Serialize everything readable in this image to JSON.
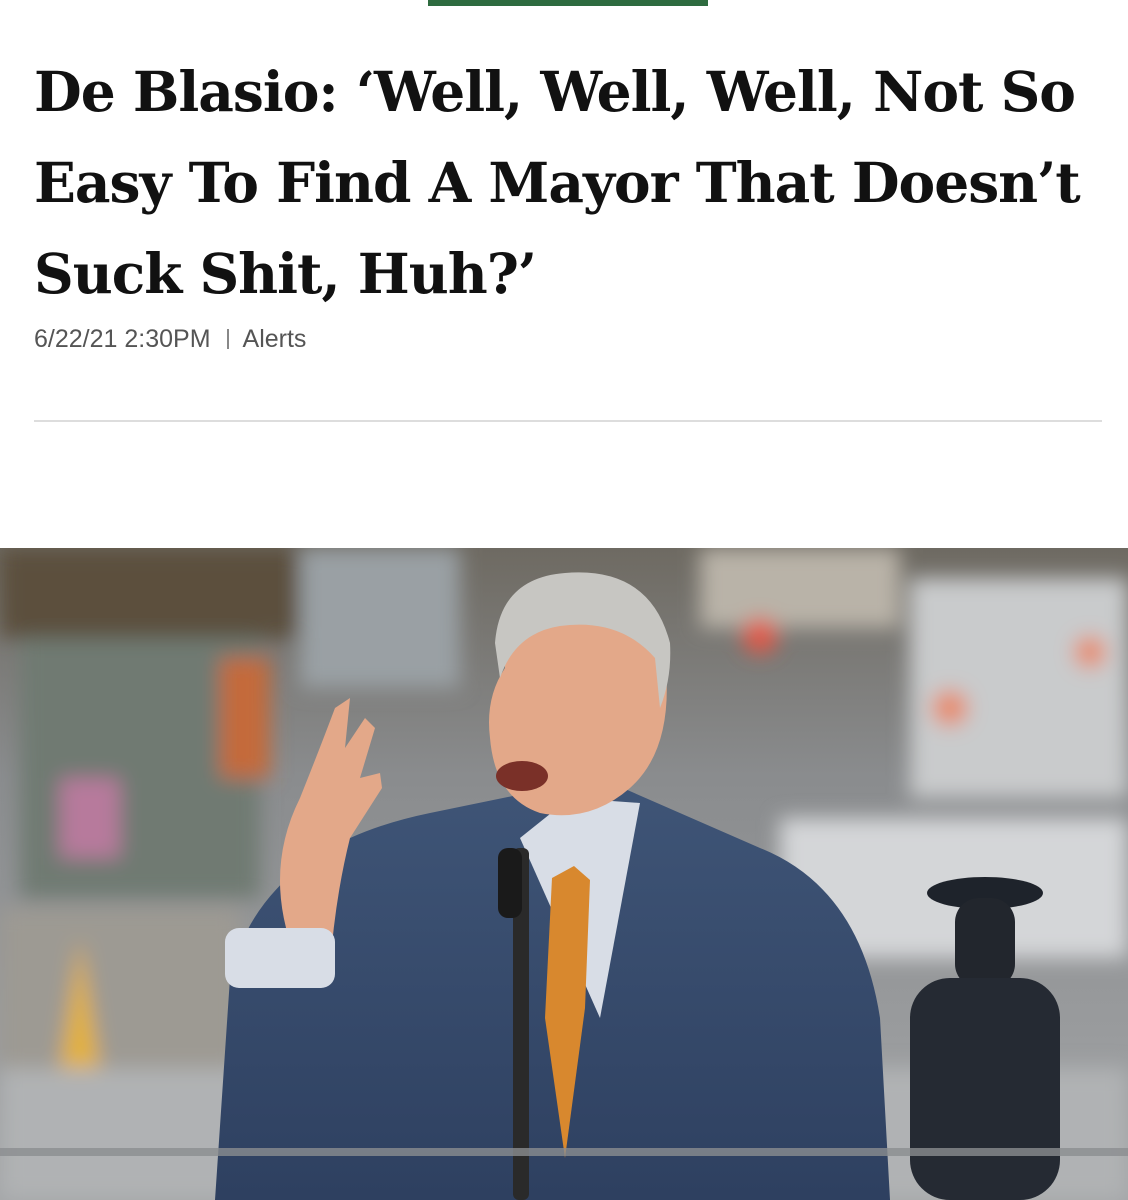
{
  "accent_color": "#2e6b3f",
  "article": {
    "headline": "De Blasio: ‘Well, Well, Well, Not So Easy To Find A Mayor That Doesn’t Suck Shit, Huh?’",
    "timestamp": "6/22/21 2:30PM",
    "category": "Alerts"
  },
  "photo": {
    "description_icon": "photo-image"
  }
}
